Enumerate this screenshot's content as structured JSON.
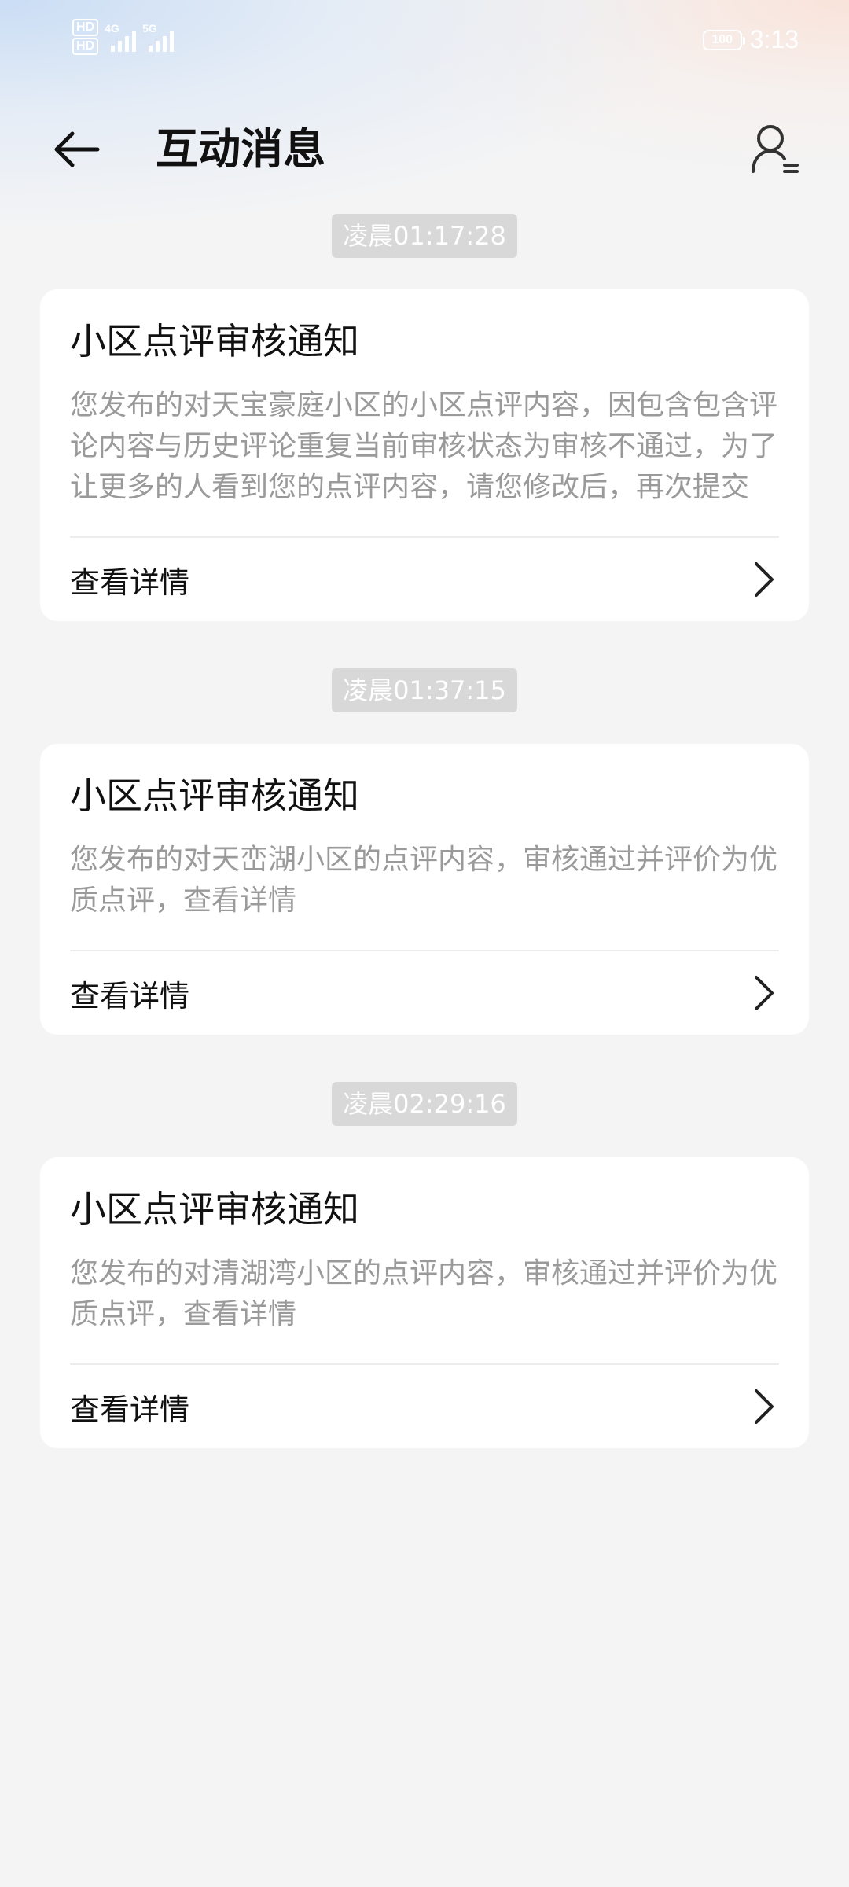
{
  "status_bar": {
    "hd1": "HD",
    "hd2": "HD",
    "net1": "4G",
    "net2": "5G",
    "battery": "100",
    "time": "3:13"
  },
  "header": {
    "title": "互动消息",
    "back_icon": "arrow-left-icon",
    "profile_icon": "user-list-icon"
  },
  "messages": [
    {
      "time": "凌晨01:17:28",
      "title": "小区点评审核通知",
      "body": "您发布的对天宝豪庭小区的小区点评内容，因包含包含评论内容与历史评论重复当前审核状态为审核不通过，为了让更多的人看到您的点评内容，请您修改后，再次提交",
      "action": "查看详情"
    },
    {
      "time": "凌晨01:37:15",
      "title": "小区点评审核通知",
      "body": "您发布的对天峦湖小区的点评内容，审核通过并评价为优质点评，查看详情",
      "action": "查看详情"
    },
    {
      "time": "凌晨02:29:16",
      "title": "小区点评审核通知",
      "body": "您发布的对清湖湾小区的点评内容，审核通过并评价为优质点评，查看详情",
      "action": "查看详情"
    }
  ],
  "colors": {
    "background": "#f4f4f5",
    "card": "#ffffff",
    "title_text": "#111111",
    "body_text": "#9a9a9a",
    "timestamp_bg": "#d8d8d8"
  }
}
